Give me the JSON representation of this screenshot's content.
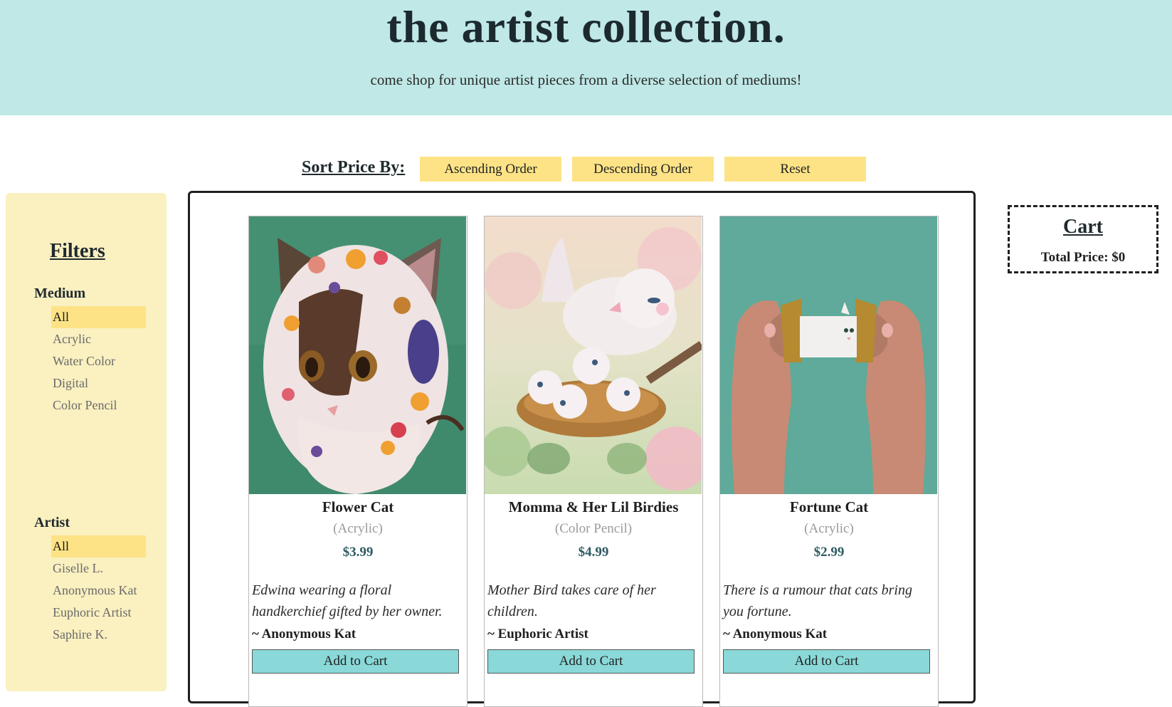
{
  "header": {
    "title": "the artist collection.",
    "subtitle": "come shop for unique artist pieces from a diverse selection of mediums!"
  },
  "sort": {
    "label": "Sort Price By:",
    "ascending": "Ascending Order",
    "descending": "Descending Order",
    "reset": "Reset"
  },
  "filters": {
    "title": "Filters",
    "medium": {
      "title": "Medium",
      "options": [
        "All",
        "Acrylic",
        "Water Color",
        "Digital",
        "Color Pencil"
      ],
      "selected": "All"
    },
    "artist": {
      "title": "Artist",
      "options": [
        "All",
        "Giselle L.",
        "Anonymous Kat",
        "Euphoric Artist",
        "Saphire K."
      ],
      "selected": "All"
    }
  },
  "products": [
    {
      "name": "Flower Cat",
      "medium": "(Acrylic)",
      "price": "$3.99",
      "description": "Edwina wearing a floral handkerchief gifted by her owner.",
      "artist": "~ Anonymous Kat",
      "button": "Add to Cart"
    },
    {
      "name": "Momma & Her Lil Birdies",
      "medium": "(Color Pencil)",
      "price": "$4.99",
      "description": "Mother Bird takes care of her children.",
      "artist": "~ Euphoric Artist",
      "button": "Add to Cart"
    },
    {
      "name": "Fortune Cat",
      "medium": "(Acrylic)",
      "price": "$2.99",
      "description": "There is a rumour that cats bring you fortune.",
      "artist": "~ Anonymous Kat",
      "button": "Add to Cart"
    }
  ],
  "cart": {
    "title": "Cart",
    "total": "Total Price: $0"
  },
  "colors": {
    "header_bg": "#bfe8e6",
    "sort_button": "#fde386",
    "sidebar_bg": "#faf0c0",
    "add_button": "#8ad8d8",
    "price_text": "#2d5a61"
  }
}
